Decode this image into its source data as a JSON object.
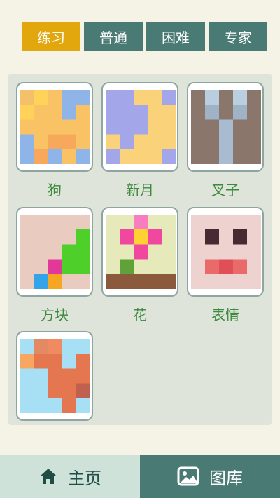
{
  "difficulty_tabs": [
    {
      "label": "练习",
      "active": true
    },
    {
      "label": "普通",
      "active": false
    },
    {
      "label": "困难",
      "active": false
    },
    {
      "label": "专家",
      "active": false
    }
  ],
  "puzzles": [
    {
      "label": "狗"
    },
    {
      "label": "新月"
    },
    {
      "label": "叉子"
    },
    {
      "label": "方块"
    },
    {
      "label": "花"
    },
    {
      "label": "表情"
    },
    {
      "label": ""
    }
  ],
  "bottom_nav": {
    "home_label": "主页",
    "home_icon": "house-icon",
    "gallery_label": "图库",
    "gallery_icon": "image-icon"
  },
  "colors": {
    "accent": "#e3a70e",
    "teal": "#4a7a74",
    "label_green": "#3c8a3c"
  }
}
